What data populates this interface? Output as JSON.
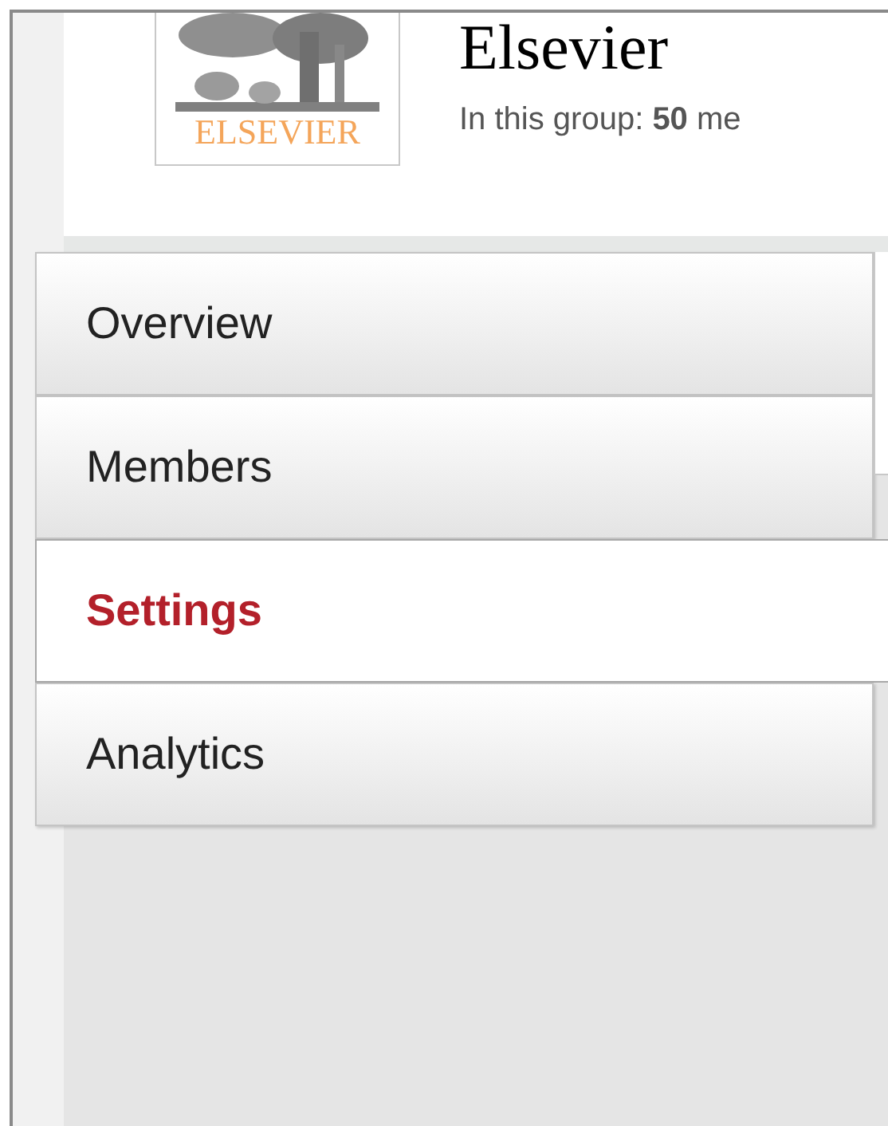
{
  "header": {
    "logo_text": "ELSEVIER",
    "title": "Elsevier",
    "group_info": "In this group: **50** me"
  },
  "nav": [
    {
      "label": "Overview",
      "selected": false
    },
    {
      "label": "Members",
      "selected": false
    },
    {
      "label": "Settings",
      "selected": true
    },
    {
      "label": "Analytics",
      "selected": false
    }
  ]
}
